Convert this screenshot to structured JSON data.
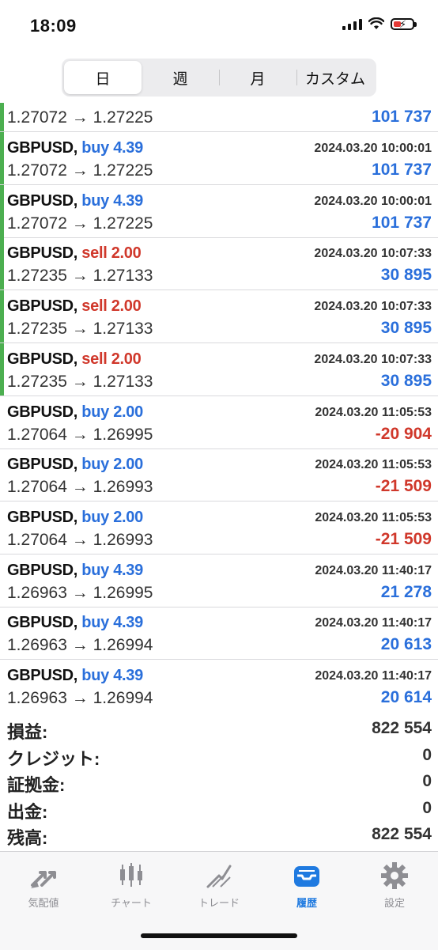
{
  "status": {
    "time": "18:09"
  },
  "tabs": [
    {
      "label": "日",
      "active": true
    },
    {
      "label": "週",
      "active": false
    },
    {
      "label": "月",
      "active": false
    },
    {
      "label": "カスタム",
      "active": false
    }
  ],
  "first_row": {
    "prices": "1.27072 → 1.27225",
    "profit": "101 737"
  },
  "trades": [
    {
      "symbol": "GBPUSD,",
      "side": "buy 4.39",
      "type": "buy",
      "time": "2024.03.20 10:00:01",
      "prices": "1.27072 → 1.27225",
      "profit": "101 737",
      "positive": true,
      "open": true
    },
    {
      "symbol": "GBPUSD,",
      "side": "buy 4.39",
      "type": "buy",
      "time": "2024.03.20 10:00:01",
      "prices": "1.27072 → 1.27225",
      "profit": "101 737",
      "positive": true,
      "open": true
    },
    {
      "symbol": "GBPUSD,",
      "side": "sell 2.00",
      "type": "sell",
      "time": "2024.03.20 10:07:33",
      "prices": "1.27235 → 1.27133",
      "profit": "30 895",
      "positive": true,
      "open": true
    },
    {
      "symbol": "GBPUSD,",
      "side": "sell 2.00",
      "type": "sell",
      "time": "2024.03.20 10:07:33",
      "prices": "1.27235 → 1.27133",
      "profit": "30 895",
      "positive": true,
      "open": true
    },
    {
      "symbol": "GBPUSD,",
      "side": "sell 2.00",
      "type": "sell",
      "time": "2024.03.20 10:07:33",
      "prices": "1.27235 → 1.27133",
      "profit": "30 895",
      "positive": true,
      "open": true
    },
    {
      "symbol": "GBPUSD,",
      "side": "buy 2.00",
      "type": "buy",
      "time": "2024.03.20 11:05:53",
      "prices": "1.27064 → 1.26995",
      "profit": "-20 904",
      "positive": false,
      "open": false
    },
    {
      "symbol": "GBPUSD,",
      "side": "buy 2.00",
      "type": "buy",
      "time": "2024.03.20 11:05:53",
      "prices": "1.27064 → 1.26993",
      "profit": "-21 509",
      "positive": false,
      "open": false
    },
    {
      "symbol": "GBPUSD,",
      "side": "buy 2.00",
      "type": "buy",
      "time": "2024.03.20 11:05:53",
      "prices": "1.27064 → 1.26993",
      "profit": "-21 509",
      "positive": false,
      "open": false
    },
    {
      "symbol": "GBPUSD,",
      "side": "buy 4.39",
      "type": "buy",
      "time": "2024.03.20 11:40:17",
      "prices": "1.26963 → 1.26995",
      "profit": "21 278",
      "positive": true,
      "open": false
    },
    {
      "symbol": "GBPUSD,",
      "side": "buy 4.39",
      "type": "buy",
      "time": "2024.03.20 11:40:17",
      "prices": "1.26963 → 1.26994",
      "profit": "20 613",
      "positive": true,
      "open": false
    },
    {
      "symbol": "GBPUSD,",
      "side": "buy 4.39",
      "type": "buy",
      "time": "2024.03.20 11:40:17",
      "prices": "1.26963 → 1.26994",
      "profit": "20 614",
      "positive": true,
      "open": false
    }
  ],
  "summary": [
    {
      "label": "損益:",
      "value": "822 554"
    },
    {
      "label": "クレジット:",
      "value": "0"
    },
    {
      "label": "証拠金:",
      "value": "0"
    },
    {
      "label": "出金:",
      "value": "0"
    },
    {
      "label": "残高:",
      "value": "822 554"
    }
  ],
  "tabbar": [
    {
      "label": "気配値",
      "icon": "quotes-icon",
      "active": false
    },
    {
      "label": "チャート",
      "icon": "candlestick-chart-icon",
      "active": false
    },
    {
      "label": "トレード",
      "icon": "trade-icon",
      "active": false
    },
    {
      "label": "履歴",
      "icon": "history-inbox-icon",
      "active": true
    },
    {
      "label": "設定",
      "icon": "gear-icon",
      "active": false
    }
  ],
  "colors": {
    "buy": "#2a6fdb",
    "sell": "#d0382b",
    "accent": "#1f7ae0",
    "open_bar": "#4caf50"
  }
}
